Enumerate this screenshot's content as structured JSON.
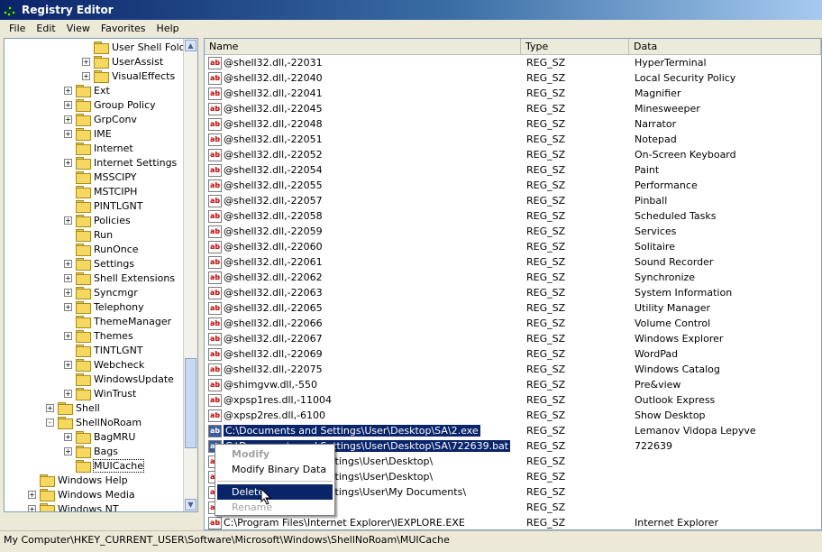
{
  "window": {
    "title": "Registry Editor"
  },
  "menubar": [
    "File",
    "Edit",
    "View",
    "Favorites",
    "Help"
  ],
  "tree": {
    "items": [
      {
        "label": "User Shell Folc",
        "expander": ""
      },
      {
        "label": "UserAssist",
        "expander": "+"
      },
      {
        "label": "VisualEffects",
        "expander": "+"
      },
      {
        "label": "Ext",
        "expander": "+"
      },
      {
        "label": "Group Policy",
        "expander": "+"
      },
      {
        "label": "GrpConv",
        "expander": "+"
      },
      {
        "label": "IME",
        "expander": "+"
      },
      {
        "label": "Internet",
        "expander": ""
      },
      {
        "label": "Internet Settings",
        "expander": "+"
      },
      {
        "label": "MSSCIPY",
        "expander": ""
      },
      {
        "label": "MSTCIPH",
        "expander": ""
      },
      {
        "label": "PINTLGNT",
        "expander": ""
      },
      {
        "label": "Policies",
        "expander": "+"
      },
      {
        "label": "Run",
        "expander": ""
      },
      {
        "label": "RunOnce",
        "expander": ""
      },
      {
        "label": "Settings",
        "expander": "+"
      },
      {
        "label": "Shell Extensions",
        "expander": "+"
      },
      {
        "label": "Syncmgr",
        "expander": "+"
      },
      {
        "label": "Telephony",
        "expander": "+"
      },
      {
        "label": "ThemeManager",
        "expander": ""
      },
      {
        "label": "Themes",
        "expander": "+"
      },
      {
        "label": "TINTLGNT",
        "expander": ""
      },
      {
        "label": "Webcheck",
        "expander": "+"
      },
      {
        "label": "WindowsUpdate",
        "expander": ""
      },
      {
        "label": "WinTrust",
        "expander": "+"
      },
      {
        "label": "Shell",
        "expander": "+"
      },
      {
        "label": "ShellNoRoam",
        "expander": "-"
      },
      {
        "label": "BagMRU",
        "expander": "+"
      },
      {
        "label": "Bags",
        "expander": "+"
      },
      {
        "label": "MUICache",
        "expander": ""
      },
      {
        "label": "Windows Help",
        "expander": ""
      },
      {
        "label": "Windows Media",
        "expander": "+"
      },
      {
        "label": "Windows NT",
        "expander": "+"
      }
    ]
  },
  "list": {
    "columns": [
      "Name",
      "Type",
      "Data"
    ],
    "rows": [
      {
        "name": "@shell32.dll,-22031",
        "type": "REG_SZ",
        "data": "HyperTerminal"
      },
      {
        "name": "@shell32.dll,-22040",
        "type": "REG_SZ",
        "data": "Local Security Policy"
      },
      {
        "name": "@shell32.dll,-22041",
        "type": "REG_SZ",
        "data": "Magnifier"
      },
      {
        "name": "@shell32.dll,-22045",
        "type": "REG_SZ",
        "data": "Minesweeper"
      },
      {
        "name": "@shell32.dll,-22048",
        "type": "REG_SZ",
        "data": "Narrator"
      },
      {
        "name": "@shell32.dll,-22051",
        "type": "REG_SZ",
        "data": "Notepad"
      },
      {
        "name": "@shell32.dll,-22052",
        "type": "REG_SZ",
        "data": "On-Screen Keyboard"
      },
      {
        "name": "@shell32.dll,-22054",
        "type": "REG_SZ",
        "data": "Paint"
      },
      {
        "name": "@shell32.dll,-22055",
        "type": "REG_SZ",
        "data": "Performance"
      },
      {
        "name": "@shell32.dll,-22057",
        "type": "REG_SZ",
        "data": "Pinball"
      },
      {
        "name": "@shell32.dll,-22058",
        "type": "REG_SZ",
        "data": "Scheduled Tasks"
      },
      {
        "name": "@shell32.dll,-22059",
        "type": "REG_SZ",
        "data": "Services"
      },
      {
        "name": "@shell32.dll,-22060",
        "type": "REG_SZ",
        "data": "Solitaire"
      },
      {
        "name": "@shell32.dll,-22061",
        "type": "REG_SZ",
        "data": "Sound Recorder"
      },
      {
        "name": "@shell32.dll,-22062",
        "type": "REG_SZ",
        "data": "Synchronize"
      },
      {
        "name": "@shell32.dll,-22063",
        "type": "REG_SZ",
        "data": "System Information"
      },
      {
        "name": "@shell32.dll,-22065",
        "type": "REG_SZ",
        "data": "Utility Manager"
      },
      {
        "name": "@shell32.dll,-22066",
        "type": "REG_SZ",
        "data": "Volume Control"
      },
      {
        "name": "@shell32.dll,-22067",
        "type": "REG_SZ",
        "data": "Windows Explorer"
      },
      {
        "name": "@shell32.dll,-22069",
        "type": "REG_SZ",
        "data": "WordPad"
      },
      {
        "name": "@shell32.dll,-22075",
        "type": "REG_SZ",
        "data": "Windows Catalog"
      },
      {
        "name": "@shimgvw.dll,-550",
        "type": "REG_SZ",
        "data": "Pre&view"
      },
      {
        "name": "@xpsp1res.dll,-11004",
        "type": "REG_SZ",
        "data": "Outlook Express"
      },
      {
        "name": "@xpsp2res.dll,-6100",
        "type": "REG_SZ",
        "data": "Show Desktop"
      },
      {
        "name": "C:\\Documents and Settings\\User\\Desktop\\SA\\2.exe",
        "type": "REG_SZ",
        "data": "Lemanov Vidopa Lepyve",
        "selected": true
      },
      {
        "name": "C:\\Documents and Settings\\User\\Desktop\\SA\\722639.bat",
        "type": "REG_SZ",
        "data": "722639",
        "selected": true
      },
      {
        "name": "C:\\Documents and Settings\\User\\Desktop\\",
        "type": "REG_SZ",
        "data": ""
      },
      {
        "name": "C:\\Documents and Settings\\User\\Desktop\\",
        "type": "REG_SZ",
        "data": ""
      },
      {
        "name": "C:\\Documents and Settings\\User\\My Documents\\",
        "type": "REG_SZ",
        "data": ""
      },
      {
        "name": "",
        "type": "REG_SZ",
        "data": ""
      },
      {
        "name": "C:\\Program Files\\Internet Explorer\\IEXPLORE.EXE",
        "type": "REG_SZ",
        "data": "Internet Explorer"
      }
    ]
  },
  "context_menu": {
    "modify": "Modify",
    "modify_binary": "Modify Binary Data",
    "delete": "Delete",
    "rename": "Rename"
  },
  "status_bar": "My Computer\\HKEY_CURRENT_USER\\Software\\Microsoft\\Windows\\ShellNoRoam\\MUICache"
}
